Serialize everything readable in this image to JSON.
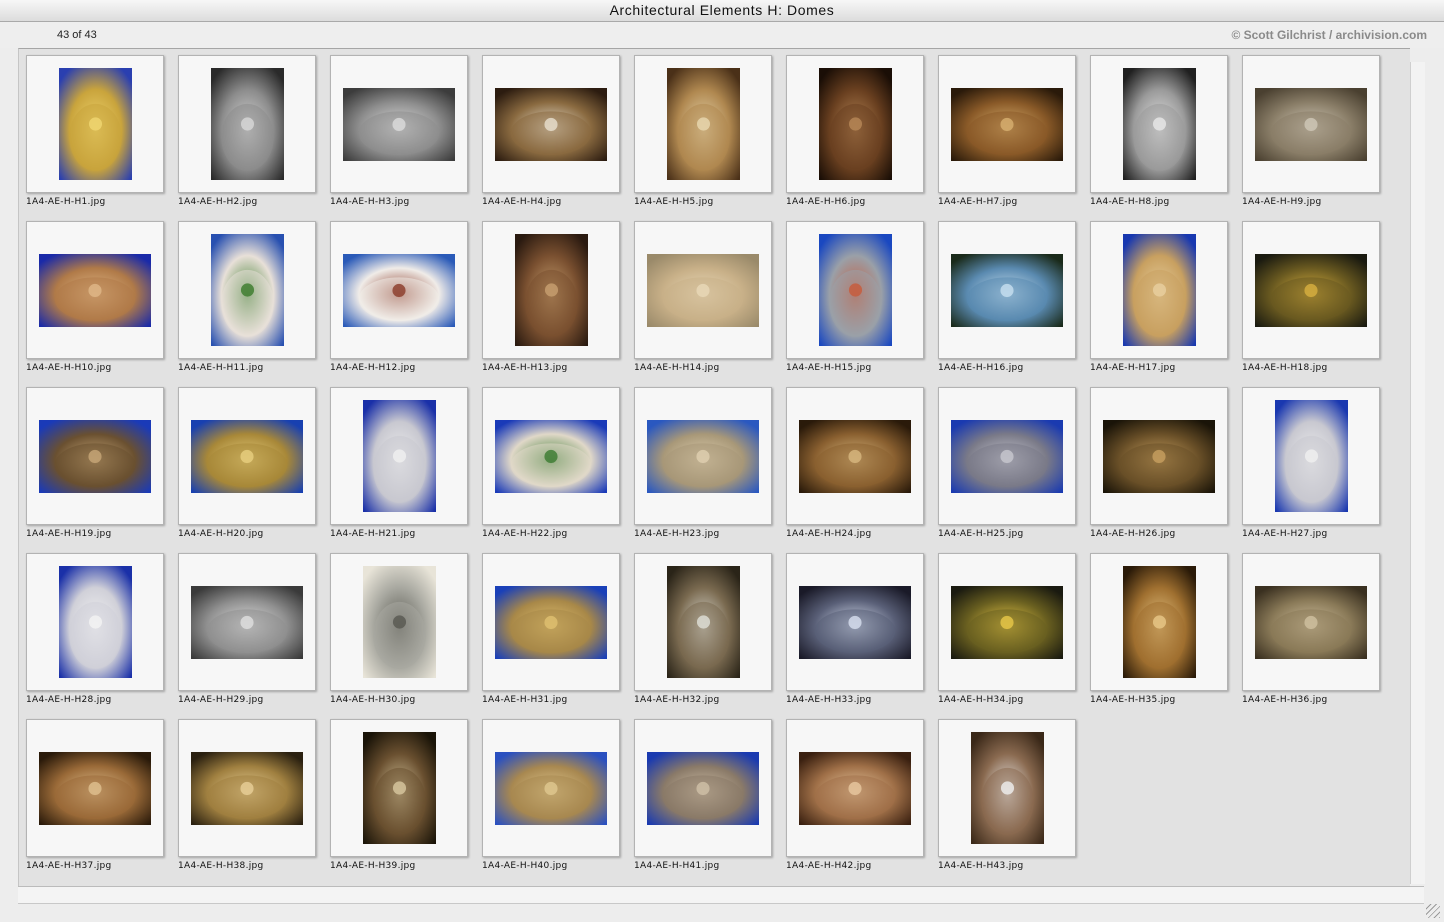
{
  "window": {
    "title": "Architectural Elements H: Domes"
  },
  "toolbar": {
    "count": "43 of 43",
    "credit": "© Scott Gilchrist / archivision.com"
  },
  "images": [
    {
      "file": "1A4-AE-H-H1.jpg",
      "orient": "portrait",
      "palette": [
        "#2a3fb0",
        "#c9a43c",
        "#f0d772"
      ]
    },
    {
      "file": "1A4-AE-H-H2.jpg",
      "orient": "portrait",
      "palette": [
        "#2a2a2a",
        "#8c8c8c",
        "#d8d8d8"
      ]
    },
    {
      "file": "1A4-AE-H-H3.jpg",
      "orient": "landscape",
      "palette": [
        "#3c3c3c",
        "#8e8e8e",
        "#dcdcdc"
      ]
    },
    {
      "file": "1A4-AE-H-H4.jpg",
      "orient": "landscape",
      "palette": [
        "#2c1c10",
        "#8a6a40",
        "#e8e0d0"
      ]
    },
    {
      "file": "1A4-AE-H-H5.jpg",
      "orient": "portrait",
      "palette": [
        "#4a3018",
        "#b08850",
        "#e8d8b0"
      ]
    },
    {
      "file": "1A4-AE-H-H6.jpg",
      "orient": "portrait",
      "palette": [
        "#1a0e06",
        "#6a4020",
        "#b88858"
      ]
    },
    {
      "file": "1A4-AE-H-H7.jpg",
      "orient": "landscape",
      "palette": [
        "#2a1a0a",
        "#8a5a28",
        "#d8b070"
      ]
    },
    {
      "file": "1A4-AE-H-H8.jpg",
      "orient": "portrait",
      "palette": [
        "#202020",
        "#9a9a9a",
        "#e8e8e8"
      ]
    },
    {
      "file": "1A4-AE-H-H9.jpg",
      "orient": "landscape",
      "palette": [
        "#4a4030",
        "#8a7e68",
        "#d0c8b8"
      ]
    },
    {
      "file": "1A4-AE-H-H10.jpg",
      "orient": "landscape",
      "palette": [
        "#1a2aa8",
        "#b07a48",
        "#e0b888"
      ]
    },
    {
      "file": "1A4-AE-H-H11.jpg",
      "orient": "portrait",
      "palette": [
        "#2850b0",
        "#e8e0d8",
        "#3a7a2a"
      ]
    },
    {
      "file": "1A4-AE-H-H12.jpg",
      "orient": "landscape",
      "palette": [
        "#2a5ab8",
        "#f0ece8",
        "#8a3a28"
      ]
    },
    {
      "file": "1A4-AE-H-H13.jpg",
      "orient": "portrait",
      "palette": [
        "#2a1a10",
        "#7a5030",
        "#c8a070"
      ]
    },
    {
      "file": "1A4-AE-H-H14.jpg",
      "orient": "landscape",
      "palette": [
        "#9a8a6a",
        "#c8b088",
        "#e8d8b8"
      ]
    },
    {
      "file": "1A4-AE-H-H15.jpg",
      "orient": "portrait",
      "palette": [
        "#1a48c0",
        "#9aa0a8",
        "#c85a3a"
      ]
    },
    {
      "file": "1A4-AE-H-H16.jpg",
      "orient": "landscape",
      "palette": [
        "#1a2a1a",
        "#5a8ab0",
        "#c8e0f0"
      ]
    },
    {
      "file": "1A4-AE-H-H17.jpg",
      "orient": "portrait",
      "palette": [
        "#1838b0",
        "#c8a060",
        "#e8d0a0"
      ]
    },
    {
      "file": "1A4-AE-H-H18.jpg",
      "orient": "landscape",
      "palette": [
        "#1a1a10",
        "#6a5a20",
        "#d8b040"
      ]
    },
    {
      "file": "1A4-AE-H-H19.jpg",
      "orient": "landscape",
      "palette": [
        "#1a3ab8",
        "#6a5030",
        "#c8a878"
      ]
    },
    {
      "file": "1A4-AE-H-H20.jpg",
      "orient": "landscape",
      "palette": [
        "#1840b0",
        "#a88838",
        "#e8d080"
      ]
    },
    {
      "file": "1A4-AE-H-H21.jpg",
      "orient": "portrait",
      "palette": [
        "#1a30a8",
        "#c8c8d0",
        "#f0f0f0"
      ]
    },
    {
      "file": "1A4-AE-H-H22.jpg",
      "orient": "landscape",
      "palette": [
        "#1a3ab8",
        "#e0d8c8",
        "#3a7a30"
      ]
    },
    {
      "file": "1A4-AE-H-H23.jpg",
      "orient": "landscape",
      "palette": [
        "#2a58c0",
        "#a89878",
        "#e0d0b0"
      ]
    },
    {
      "file": "1A4-AE-H-H24.jpg",
      "orient": "landscape",
      "palette": [
        "#2a1a0a",
        "#8a6030",
        "#d8b880"
      ]
    },
    {
      "file": "1A4-AE-H-H25.jpg",
      "orient": "landscape",
      "palette": [
        "#1a3ab0",
        "#7a7a88",
        "#c8c8d0"
      ]
    },
    {
      "file": "1A4-AE-H-H26.jpg",
      "orient": "landscape",
      "palette": [
        "#1a1408",
        "#6a5028",
        "#c8a060"
      ]
    },
    {
      "file": "1A4-AE-H-H27.jpg",
      "orient": "portrait",
      "palette": [
        "#1a38b0",
        "#c8c8d0",
        "#f0f0f0"
      ]
    },
    {
      "file": "1A4-AE-H-H28.jpg",
      "orient": "portrait",
      "palette": [
        "#1a30a8",
        "#d0d0d8",
        "#f4f4f4"
      ]
    },
    {
      "file": "1A4-AE-H-H29.jpg",
      "orient": "landscape",
      "palette": [
        "#3a3a3a",
        "#909090",
        "#e0e0e0"
      ]
    },
    {
      "file": "1A4-AE-H-H30.jpg",
      "orient": "portrait",
      "palette": [
        "#e8e4d8",
        "#a8a8a0",
        "#585850"
      ]
    },
    {
      "file": "1A4-AE-H-H31.jpg",
      "orient": "landscape",
      "palette": [
        "#1a40b8",
        "#a88848",
        "#e0c070"
      ]
    },
    {
      "file": "1A4-AE-H-H32.jpg",
      "orient": "portrait",
      "palette": [
        "#2a2418",
        "#7a6a50",
        "#e0e0d8"
      ]
    },
    {
      "file": "1A4-AE-H-H33.jpg",
      "orient": "landscape",
      "palette": [
        "#1a1a28",
        "#5a6078",
        "#d8e0f0"
      ]
    },
    {
      "file": "1A4-AE-H-H34.jpg",
      "orient": "landscape",
      "palette": [
        "#1a1a10",
        "#6a6020",
        "#e8c848"
      ]
    },
    {
      "file": "1A4-AE-H-H35.jpg",
      "orient": "portrait",
      "palette": [
        "#2a1a08",
        "#a07030",
        "#e8c888"
      ]
    },
    {
      "file": "1A4-AE-H-H36.jpg",
      "orient": "landscape",
      "palette": [
        "#3a3020",
        "#8a7a58",
        "#d0c0a0"
      ]
    },
    {
      "file": "1A4-AE-H-H37.jpg",
      "orient": "landscape",
      "palette": [
        "#2a1a0a",
        "#9a6a38",
        "#e0c090"
      ]
    },
    {
      "file": "1A4-AE-H-H38.jpg",
      "orient": "landscape",
      "palette": [
        "#2a2010",
        "#a08040",
        "#e8d098"
      ]
    },
    {
      "file": "1A4-AE-H-H39.jpg",
      "orient": "portrait",
      "palette": [
        "#1a1408",
        "#6a5030",
        "#d8c8a0"
      ]
    },
    {
      "file": "1A4-AE-H-H40.jpg",
      "orient": "landscape",
      "palette": [
        "#2a50c0",
        "#a88850",
        "#e0c890"
      ]
    },
    {
      "file": "1A4-AE-H-H41.jpg",
      "orient": "landscape",
      "palette": [
        "#1a3ab0",
        "#8a7a68",
        "#d0c0a8"
      ]
    },
    {
      "file": "1A4-AE-H-H42.jpg",
      "orient": "landscape",
      "palette": [
        "#3a2010",
        "#a07048",
        "#e8c8a0"
      ]
    },
    {
      "file": "1A4-AE-H-H43.jpg",
      "orient": "portrait",
      "palette": [
        "#3a2818",
        "#8a6a50",
        "#f0f0f0"
      ]
    }
  ]
}
